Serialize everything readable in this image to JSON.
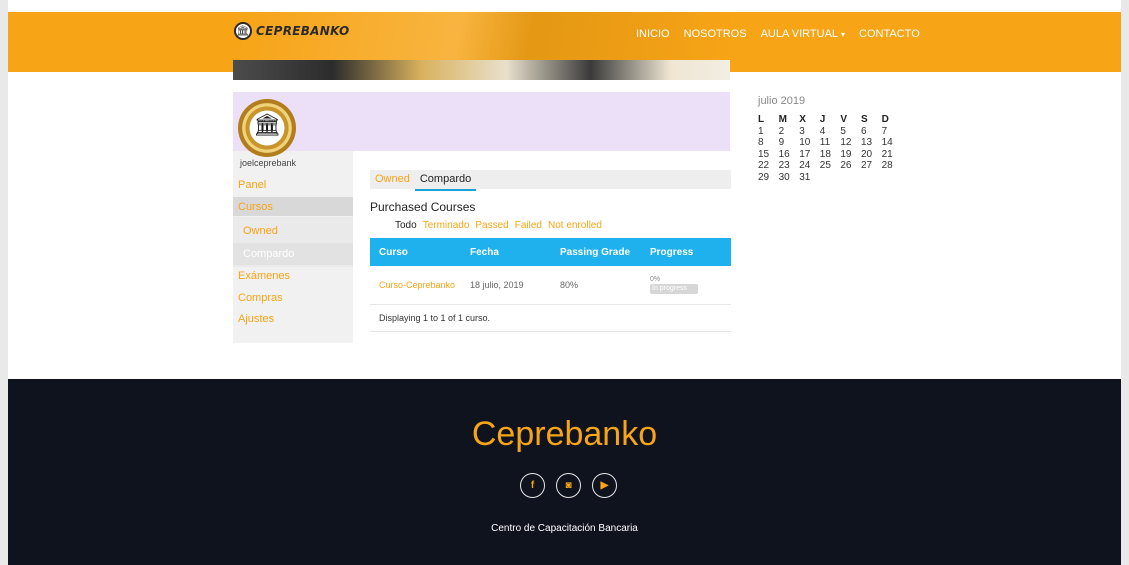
{
  "header": {
    "brand": "CEPREBANKO",
    "nav": [
      {
        "label": "INICIO"
      },
      {
        "label": "NOSOTROS"
      },
      {
        "label": "AULA VIRTUAL"
      },
      {
        "label": "CONTACTO"
      }
    ],
    "dropdown_caret": "▾"
  },
  "profile": {
    "username": "joelceprebank"
  },
  "sidebar": {
    "items": [
      {
        "label": "Panel"
      },
      {
        "label": "Cursos"
      },
      {
        "label": "Owned"
      },
      {
        "label": "Compardo"
      },
      {
        "label": "Exámenes"
      },
      {
        "label": "Compras"
      },
      {
        "label": "Ajustes"
      }
    ]
  },
  "tabs": [
    {
      "label": "Owned"
    },
    {
      "label": "Compardo"
    }
  ],
  "section": {
    "title": "Purchased Courses",
    "filters": [
      {
        "label": "Todo"
      },
      {
        "label": "Terminado"
      },
      {
        "label": "Passed"
      },
      {
        "label": "Failed"
      },
      {
        "label": "Not enrolled"
      }
    ]
  },
  "table": {
    "headers": [
      "Curso",
      "Fecha",
      "Passing Grade",
      "Progress"
    ],
    "rows": [
      {
        "curso": "Curso-Ceprebanko",
        "fecha": "18 julio, 2019",
        "grade": "80%",
        "progress_pct": "0%",
        "status": "In progress"
      }
    ],
    "footer": "Displaying 1 to 1 of 1 curso."
  },
  "calendar": {
    "title": "julio 2019",
    "days": [
      "L",
      "M",
      "X",
      "J",
      "V",
      "S",
      "D"
    ],
    "weeks": [
      [
        "1",
        "2",
        "3",
        "4",
        "5",
        "6",
        "7"
      ],
      [
        "8",
        "9",
        "10",
        "11",
        "12",
        "13",
        "14"
      ],
      [
        "15",
        "16",
        "17",
        "18",
        "19",
        "20",
        "21"
      ],
      [
        "22",
        "23",
        "24",
        "25",
        "26",
        "27",
        "28"
      ],
      [
        "29",
        "30",
        "31",
        "",
        "",
        "",
        ""
      ]
    ]
  },
  "footer": {
    "title": "Ceprebanko",
    "social": [
      {
        "icon": "facebook-icon",
        "glyph": "f"
      },
      {
        "icon": "instagram-icon",
        "glyph": "◙"
      },
      {
        "icon": "youtube-icon",
        "glyph": "▶"
      }
    ],
    "subtitle": "Centro de Capacitación Bancaria"
  },
  "colors": {
    "accent": "#f7a416",
    "table_header": "#1eb1ee",
    "footer_bg": "#0f131d",
    "profile_band": "#ecdff8"
  }
}
